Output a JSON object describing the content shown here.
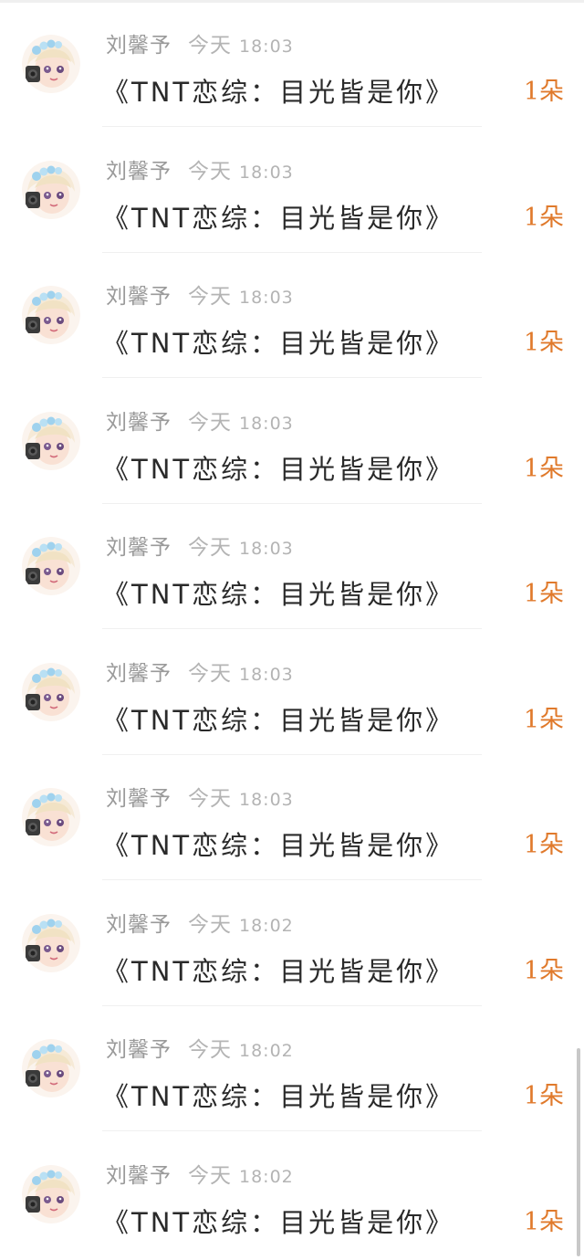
{
  "messages": [
    {
      "user": "刘馨予",
      "day": "今天",
      "time": "18:03",
      "gift": "《TNT恋综：目光皆是你》",
      "count": "1朵"
    },
    {
      "user": "刘馨予",
      "day": "今天",
      "time": "18:03",
      "gift": "《TNT恋综：目光皆是你》",
      "count": "1朵"
    },
    {
      "user": "刘馨予",
      "day": "今天",
      "time": "18:03",
      "gift": "《TNT恋综：目光皆是你》",
      "count": "1朵"
    },
    {
      "user": "刘馨予",
      "day": "今天",
      "time": "18:03",
      "gift": "《TNT恋综：目光皆是你》",
      "count": "1朵"
    },
    {
      "user": "刘馨予",
      "day": "今天",
      "time": "18:03",
      "gift": "《TNT恋综：目光皆是你》",
      "count": "1朵"
    },
    {
      "user": "刘馨予",
      "day": "今天",
      "time": "18:03",
      "gift": "《TNT恋综：目光皆是你》",
      "count": "1朵"
    },
    {
      "user": "刘馨予",
      "day": "今天",
      "time": "18:03",
      "gift": "《TNT恋综：目光皆是你》",
      "count": "1朵"
    },
    {
      "user": "刘馨予",
      "day": "今天",
      "time": "18:02",
      "gift": "《TNT恋综：目光皆是你》",
      "count": "1朵"
    },
    {
      "user": "刘馨予",
      "day": "今天",
      "time": "18:02",
      "gift": "《TNT恋综：目光皆是你》",
      "count": "1朵"
    },
    {
      "user": "刘馨予",
      "day": "今天",
      "time": "18:02",
      "gift": "《TNT恋综：目光皆是你》",
      "count": "1朵"
    }
  ],
  "colors": {
    "count_accent": "#e07a2c",
    "meta_text": "#9a9a9a",
    "main_text": "#2a2a2a"
  },
  "icons": {
    "avatar": "avatar-cartoon-girl-icon"
  }
}
